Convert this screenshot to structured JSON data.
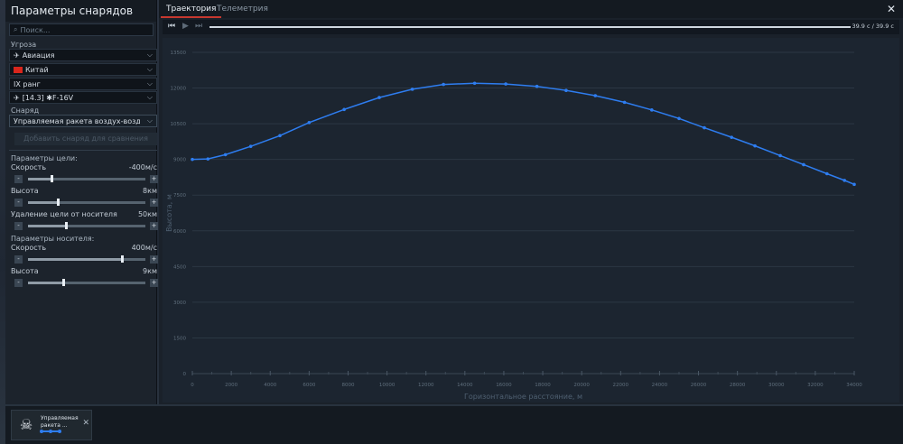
{
  "left": {
    "title": "Параметры снарядов",
    "search_placeholder": "Поиск...",
    "threat_label": "Угроза",
    "threat_type": "Авиация",
    "country": "Китай",
    "rank": "IX ранг",
    "vehicle": "[14.3] ✱F-16V",
    "shell_label": "Снаряд",
    "shell": "Управляемая ракета воздух-воздух AIM",
    "add_compare": "Добавить снаряд для сравнения",
    "target_params_label": "Параметры цели:",
    "target_speed_label": "Скорость",
    "target_speed_value": "-400м/с",
    "target_speed_pos": 0.2,
    "target_alt_label": "Высота",
    "target_alt_value": "8км",
    "target_alt_pos": 0.25,
    "target_dist_label": "Удаление цели от носителя",
    "target_dist_value": "50км",
    "target_dist_pos": 0.32,
    "carrier_params_label": "Параметры носителя:",
    "carrier_speed_label": "Скорость",
    "carrier_speed_value": "400м/с",
    "carrier_speed_pos": 0.8,
    "carrier_alt_label": "Высота",
    "carrier_alt_value": "9км",
    "carrier_alt_pos": 0.3
  },
  "tabs": [
    "Траектория",
    "Телеметрия"
  ],
  "player": {
    "time": "39.9 с  /  39.9 с",
    "progress": 1.0
  },
  "bottom": {
    "card_name": "Управляемая ракета ..."
  },
  "colors": {
    "series": "#2e7df0",
    "accent": "#c7382f"
  },
  "chart_data": {
    "type": "line",
    "title": "",
    "xlabel": "Горизонтальное расстояние, м",
    "ylabel": "Высота, м",
    "xlim": [
      0,
      34000
    ],
    "ylim": [
      0,
      13500
    ],
    "xticks": [
      0,
      2000,
      4000,
      6000,
      8000,
      10000,
      12000,
      14000,
      16000,
      18000,
      20000,
      22000,
      24000,
      26000,
      28000,
      30000,
      32000,
      34000
    ],
    "yticks": [
      0,
      1500,
      3000,
      4500,
      6000,
      7500,
      9000,
      10500,
      12000,
      13500
    ],
    "grid": true,
    "series": [
      {
        "x": [
          0,
          800,
          1700,
          3000,
          4500,
          6000,
          7800,
          9600,
          11300,
          12900,
          14500,
          16100,
          17700,
          19200,
          20700,
          22200,
          23600,
          25000,
          26300,
          27700,
          28900,
          30200,
          31400,
          32600,
          33500,
          34000
        ],
        "y": [
          9000,
          9020,
          9200,
          9550,
          10000,
          10550,
          11100,
          11600,
          11950,
          12150,
          12200,
          12170,
          12070,
          11900,
          11680,
          11400,
          11080,
          10720,
          10330,
          9930,
          9570,
          9160,
          8780,
          8400,
          8120,
          7950
        ]
      }
    ]
  }
}
